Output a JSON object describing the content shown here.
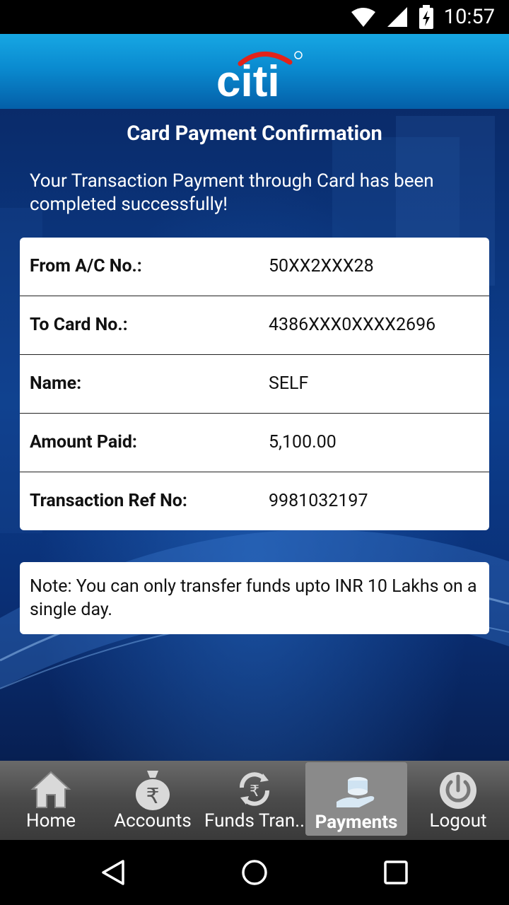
{
  "status_bar": {
    "time": "10:57",
    "icons": [
      "wifi-icon",
      "signal-icon",
      "battery-charging-icon"
    ]
  },
  "header": {
    "brand": "citi"
  },
  "main": {
    "title": "Card Payment Confirmation",
    "message": "Your Transaction Payment through Card has been completed successfully!",
    "details": [
      {
        "label": "From A/C No.:",
        "value": "50XX2XXX28"
      },
      {
        "label": "To Card No.:",
        "value": "4386XXX0XXXX2696"
      },
      {
        "label": "Name:",
        "value": "SELF"
      },
      {
        "label": "Amount Paid:",
        "value": "5,100.00"
      },
      {
        "label": "Transaction Ref No:",
        "value": "9981032197"
      }
    ],
    "note": "Note: You can only transfer funds upto INR 10 Lakhs on a single day."
  },
  "bottom_nav": {
    "items": [
      {
        "label": "Home",
        "icon": "home-icon",
        "active": false
      },
      {
        "label": "Accounts",
        "icon": "money-bag-rupee-icon",
        "active": false
      },
      {
        "label": "Funds Tran..",
        "icon": "rupee-transfer-icon",
        "active": false
      },
      {
        "label": "Payments",
        "icon": "hand-coins-icon",
        "active": true
      },
      {
        "label": "Logout",
        "icon": "power-icon",
        "active": false
      }
    ]
  },
  "system_nav": {
    "icons": [
      "back-icon",
      "home-circle-icon",
      "recents-icon"
    ]
  },
  "colors": {
    "header_blue": "#0a8bd0",
    "logo_red": "#e2231a",
    "background_navy": "#0a2b6a"
  }
}
